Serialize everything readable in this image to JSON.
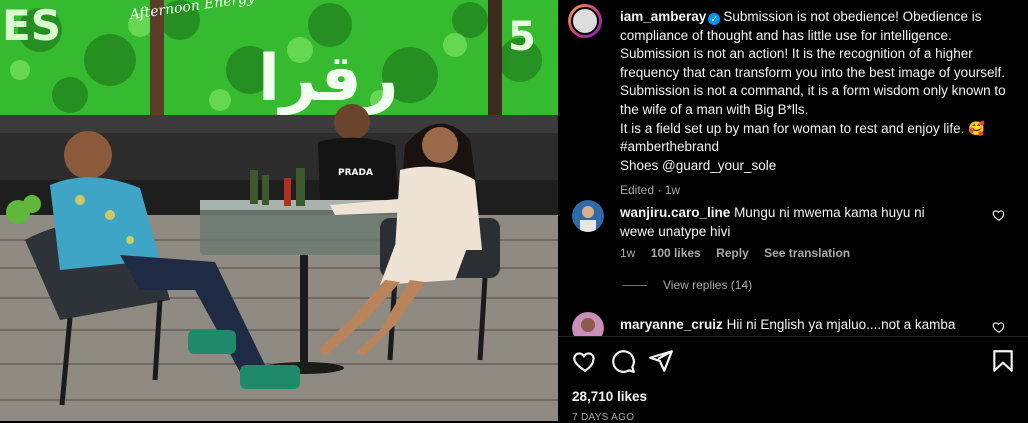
{
  "post": {
    "username": "iam_amberay",
    "caption_lines": [
      "Submission is not obedience! Obedience is compliance of thought and has little use for intelligence. Submission is not an action! It is the recognition of a higher frequency that can transform you into the best image of yourself. Submission is not a command, it is a form wisdom only known to the wife of a man with Big B*lls.",
      "It is a field set up by man for woman to rest and enjoy life. 🥰",
      "#amberthebrand",
      "Shoes @guard_your_sole"
    ],
    "edited": "Edited · 1w",
    "likes": "28,710 likes",
    "time_ago": "7 DAYS AGO"
  },
  "photo": {
    "wall_sign": "رقرا",
    "neon_script": "Afternoon Energy",
    "neon_number": "5",
    "neon_letters": "ES",
    "shirt_brand": "PRADA"
  },
  "comments": [
    {
      "username": "wanjiru.caro_line",
      "text": "Mungu ni mwema kama huyu ni wewe unatype hivi",
      "time": "1w",
      "likes": "100 likes",
      "reply": "Reply",
      "translate": "See translation",
      "view_replies": "View replies (14)"
    },
    {
      "username": "maryanne_cruiz",
      "text": "Hii ni English ya mjaluo....not a kamba please"
    }
  ],
  "icons": [
    "heart-icon",
    "comment-icon",
    "share-icon",
    "bookmark-icon",
    "verified-badge-icon"
  ],
  "colors": {
    "neon": "#39d12a",
    "verified": "#0095f6",
    "muted": "#a8a8a8"
  }
}
